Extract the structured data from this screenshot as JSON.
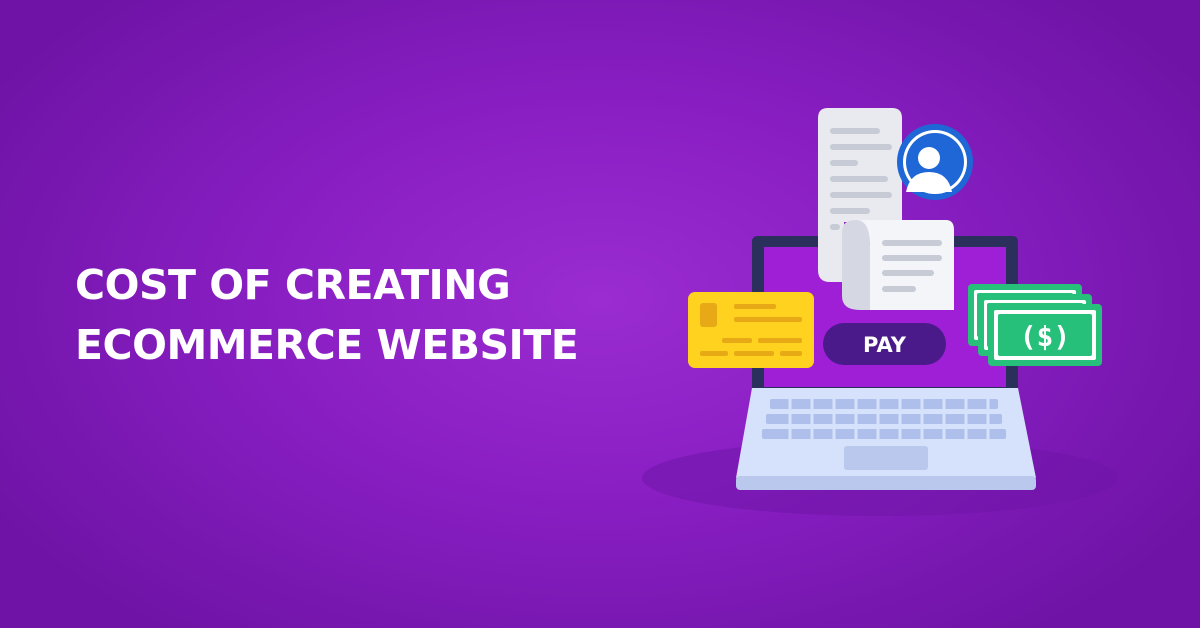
{
  "headline": {
    "line1": "COST OF CREATING",
    "line2": "ECOMMERCE WEBSITE"
  },
  "illustration": {
    "pay_button_label": "PAY",
    "money_symbol": "($)",
    "icons": [
      "laptop-icon",
      "receipt-icon",
      "user-avatar-icon",
      "credit-card-icon",
      "cash-stack-icon"
    ]
  },
  "colors": {
    "background": "#8a1fc4",
    "text": "#ffffff",
    "pay_button": "#4a1a8a",
    "card": "#ffd21f",
    "cash": "#27c07a",
    "avatar": "#1f67d6",
    "laptop_screen": "#9f1fd6",
    "laptop_body": "#d6e2fb"
  }
}
